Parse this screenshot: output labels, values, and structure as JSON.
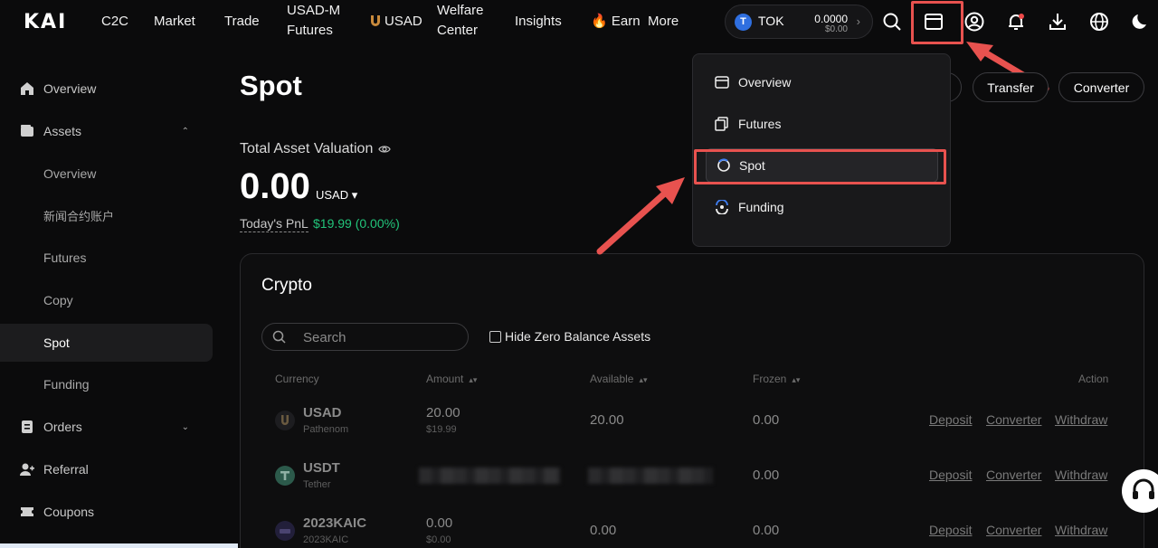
{
  "nav": {
    "logo": "KAI",
    "items": [
      "C2C",
      "Market",
      "Trade"
    ],
    "usadm_line1": "USAD-M",
    "usadm_line2": "Futures",
    "usad": "USAD",
    "welfare_line1": "Welfare",
    "welfare_line2": "Center",
    "insights": "Insights",
    "earn": "Earn",
    "earn_emoji": "🔥",
    "more": "More",
    "token": {
      "symbol": "T",
      "name": "TOK",
      "value": "0.0000",
      "usd": "$0.00",
      "arrow": "›"
    }
  },
  "sidebar": {
    "overview": "Overview",
    "assets": "Assets",
    "assets_chevron": "⌃",
    "sub": [
      "Overview",
      "新闻合约账户",
      "Futures",
      "Copy",
      "Spot",
      "Funding"
    ],
    "orders": "Orders",
    "orders_chevron": "⌄",
    "referral": "Referral",
    "coupons": "Coupons"
  },
  "main": {
    "title": "Spot",
    "transfer": "Transfer",
    "converter": "Converter",
    "valuation_label": "Total Asset Valuation",
    "valuation": "0.00",
    "currency": "USAD ▾",
    "pnl_label": "Today's PnL",
    "pnl_value": "$19.99 (0.00%)"
  },
  "crypto": {
    "title": "Crypto",
    "search_placeholder": "Search",
    "hide_zero": "Hide Zero Balance Assets",
    "headers": {
      "currency": "Currency",
      "amount": "Amount",
      "available": "Available",
      "frozen": "Frozen",
      "action": "Action"
    },
    "sort_glyph": "▴▾",
    "rows": [
      {
        "symbol": "USAD",
        "name": "Pathenom",
        "amount": "20.00",
        "amount_usd": "$19.99",
        "available": "20.00",
        "frozen": "0.00"
      },
      {
        "symbol": "USDT",
        "name": "Tether",
        "amount": "",
        "amount_usd": "",
        "available": "",
        "frozen": "0.00"
      },
      {
        "symbol": "2023KAIC",
        "name": "2023KAIC",
        "amount": "0.00",
        "amount_usd": "$0.00",
        "available": "0.00",
        "frozen": "0.00"
      }
    ],
    "actions": {
      "deposit": "Deposit",
      "converter": "Converter",
      "withdraw": "Withdraw"
    }
  },
  "dropdown": {
    "items": [
      "Overview",
      "Futures",
      "Spot",
      "Funding"
    ]
  },
  "colors": {
    "accent_green": "#22c47a",
    "highlight_red": "#e8524f"
  }
}
